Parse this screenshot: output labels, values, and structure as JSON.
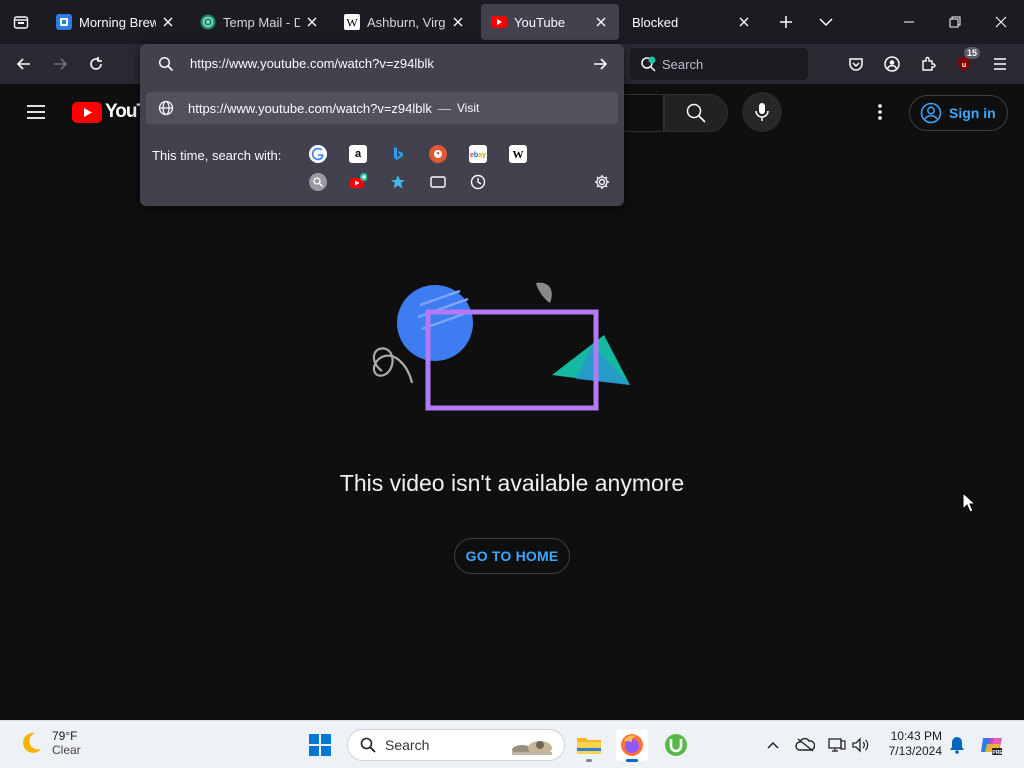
{
  "browser": {
    "tabs": [
      {
        "title": "Morning Brew",
        "icon": "morning-brew-icon",
        "active": false
      },
      {
        "title": "Temp Mail - Dis",
        "icon": "temp-mail-icon",
        "active": false
      },
      {
        "title": "Ashburn, Virgini",
        "icon": "wikipedia-icon",
        "active": false
      },
      {
        "title": "YouTube",
        "icon": "youtube-icon",
        "active": true
      },
      {
        "title": "Blocked",
        "icon": "",
        "active": false
      }
    ],
    "search_placeholder": "Search",
    "extension_badge": "15"
  },
  "urlbar": {
    "value": "https://www.youtube.com/watch?v=z94lblk",
    "suggestion_url": "https://www.youtube.com/watch?v=z94lblk",
    "suggestion_dash": "—",
    "suggestion_action": "Visit",
    "search_with_label": "This time, search with:",
    "engines": [
      "google",
      "amazon",
      "bing",
      "duckduckgo",
      "ebay",
      "wikipedia",
      "search-engine-extra",
      "youtube-add",
      "bookmarks",
      "tabs",
      "history"
    ]
  },
  "youtube": {
    "logo_text": "YouTube",
    "signin_label": "Sign in",
    "error_message": "This video isn't available anymore",
    "home_button": "GO TO HOME",
    "colors": {
      "accent": "#3ea6ff",
      "brand": "#ff0000"
    }
  },
  "taskbar": {
    "weather_temp": "79°F",
    "weather_condition": "Clear",
    "search_placeholder": "Search",
    "time": "10:43 PM",
    "date": "7/13/2024"
  }
}
